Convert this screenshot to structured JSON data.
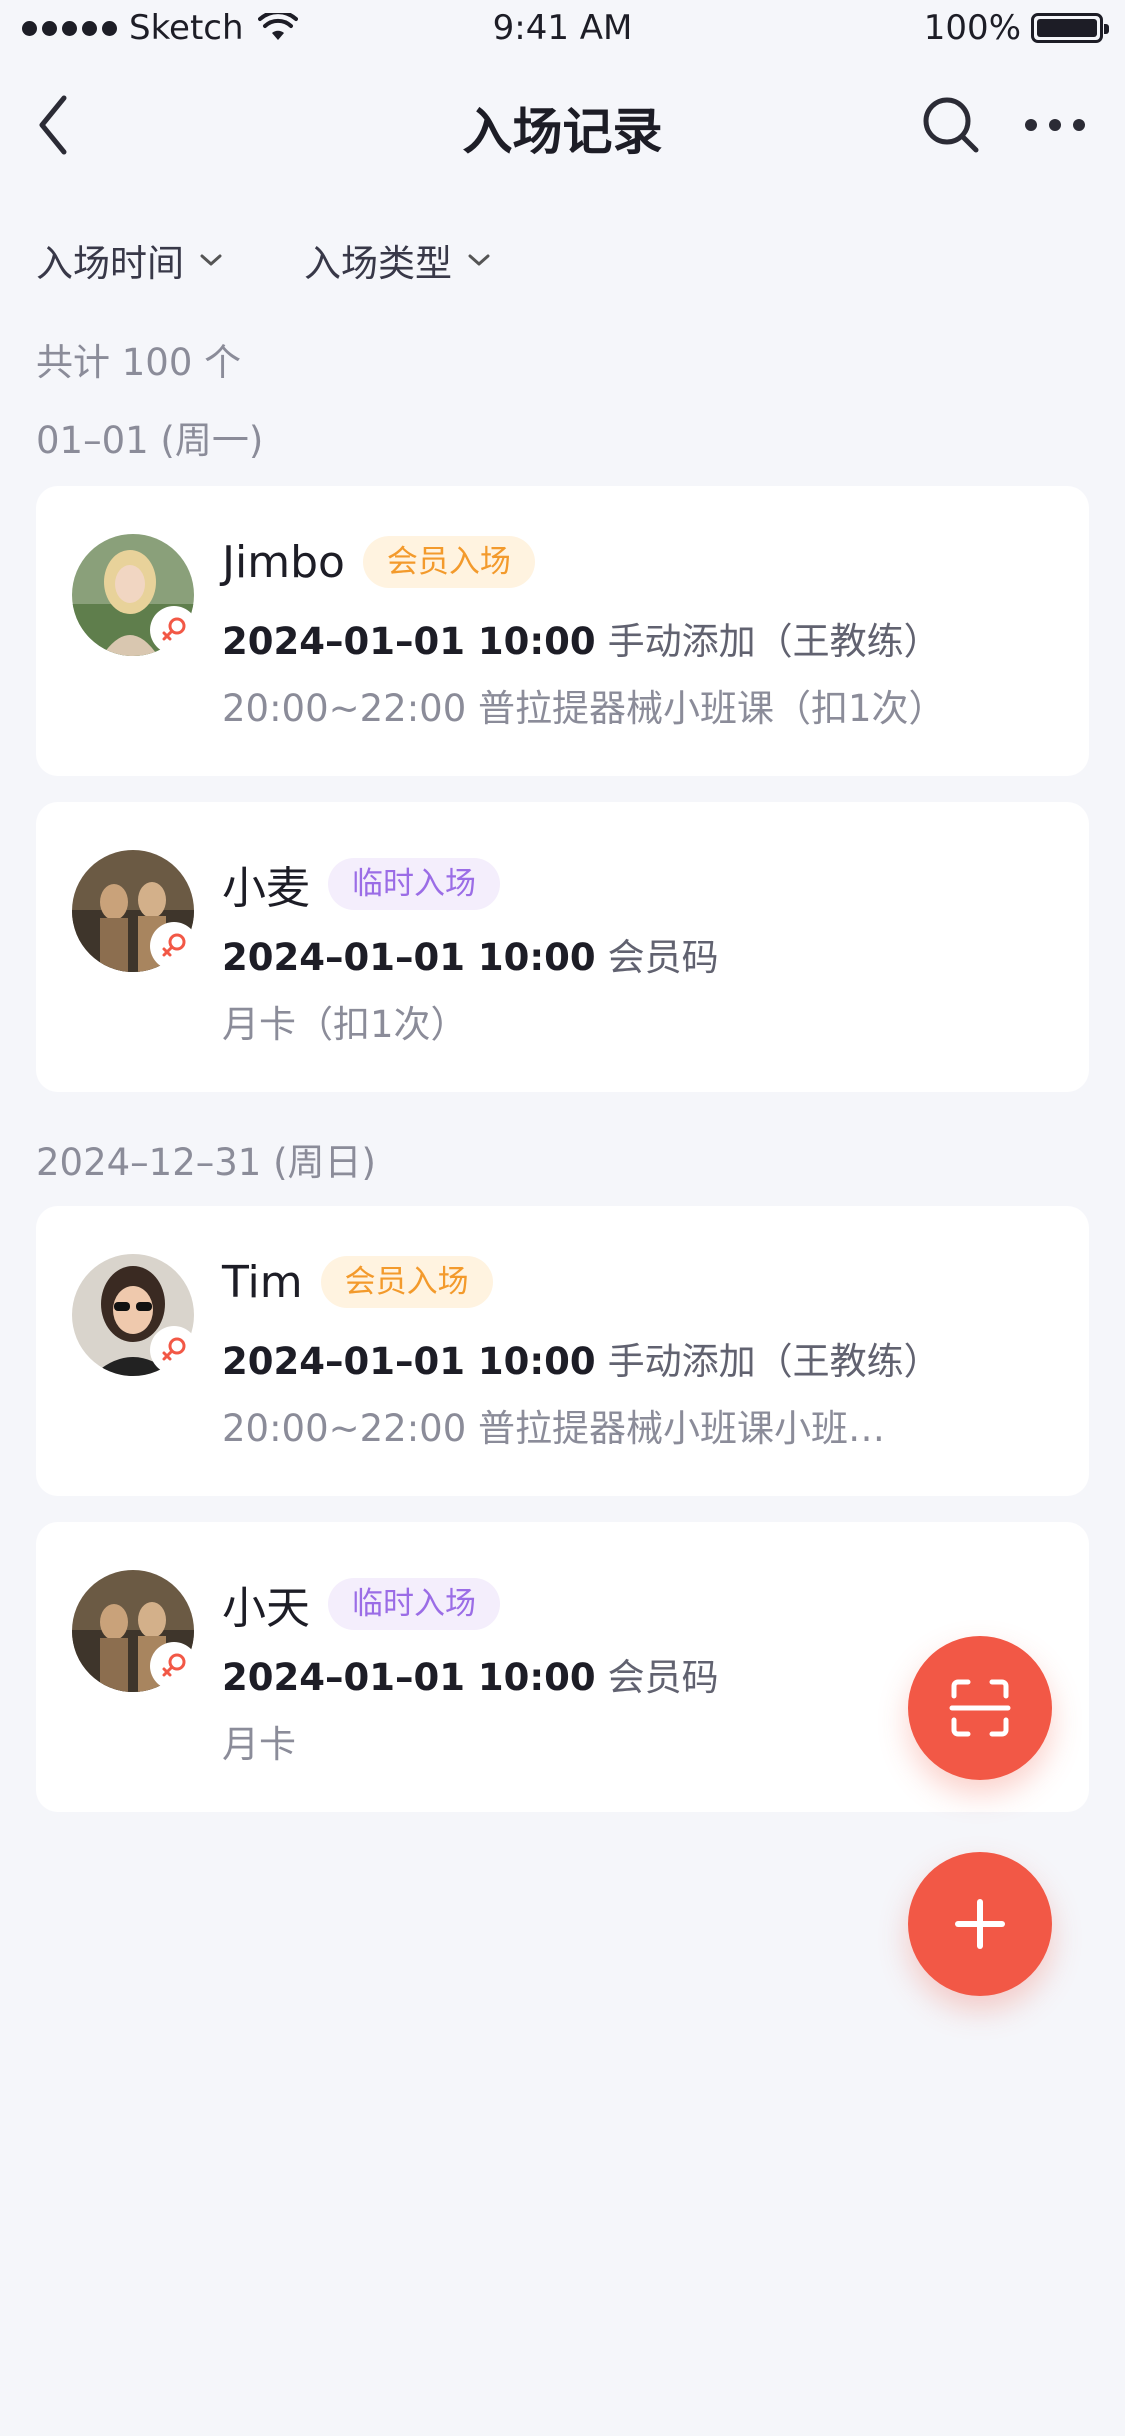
{
  "status_bar": {
    "carrier": "Sketch",
    "time": "9:41 AM",
    "battery": "100%"
  },
  "nav": {
    "title": "入场记录"
  },
  "filters": {
    "time": "入场时间",
    "type": "入场类型"
  },
  "total": "共计 100 个",
  "groups": [
    {
      "date": "01–01 (周一)",
      "records": [
        {
          "name": "Jimbo",
          "tag": "会员入场",
          "time": "2024–01–01 10:00",
          "method": "手动添加（王教练）",
          "detail": "20:00~22:00 普拉提器械小班课（扣1次）"
        },
        {
          "name": "小麦",
          "tag": "临时入场",
          "time": "2024–01–01 10:00",
          "method": "会员码",
          "detail": "月卡（扣1次）"
        }
      ]
    },
    {
      "date": "2024–12–31 (周日)",
      "records": [
        {
          "name": "Tim",
          "tag": "会员入场",
          "time": "2024–01–01 10:00",
          "method": "手动添加（王教练）",
          "detail": "20:00~22:00 普拉提器械小班课小班…"
        },
        {
          "name": "小天",
          "tag": "临时入场",
          "time": "2024–01–01 10:00",
          "method": "会员码",
          "detail": "月卡"
        }
      ]
    }
  ],
  "colors": {
    "accent": "#f25846",
    "member_tag": "#f39a2c",
    "temp_tag": "#9b6de6",
    "female_badge": "#f25846"
  },
  "icons": [
    "back-icon",
    "search-icon",
    "more-icon",
    "chevron-down-icon",
    "female-icon",
    "scan-icon",
    "plus-icon"
  ]
}
